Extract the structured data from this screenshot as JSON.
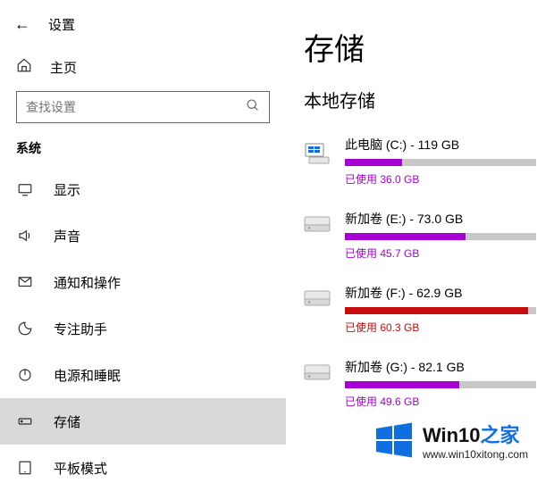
{
  "colors": {
    "purple": "#a600d4",
    "red": "#c60c0c",
    "blue": "#0f6fe0"
  },
  "sidebar": {
    "back_label": "←",
    "title": "设置",
    "home": "主页",
    "search_placeholder": "查找设置",
    "section": "系统",
    "items": [
      {
        "id": "display",
        "icon": "display",
        "label": "显示"
      },
      {
        "id": "sound",
        "icon": "sound",
        "label": "声音"
      },
      {
        "id": "notif",
        "icon": "notif",
        "label": "通知和操作"
      },
      {
        "id": "focus",
        "icon": "focus",
        "label": "专注助手"
      },
      {
        "id": "power",
        "icon": "power",
        "label": "电源和睡眠"
      },
      {
        "id": "storage",
        "icon": "storage",
        "label": "存储",
        "selected": true
      },
      {
        "id": "tablet",
        "icon": "tablet",
        "label": "平板模式"
      }
    ]
  },
  "main": {
    "heading": "存储",
    "subheading": "本地存储",
    "drives": [
      {
        "icon": "pc",
        "title": "此电脑 (C:) - 119 GB",
        "used_text": "已使用 36.0 GB",
        "pct": 30,
        "color": "#a600d4"
      },
      {
        "icon": "disk",
        "title": "新加卷 (E:) - 73.0 GB",
        "used_text": "已使用 45.7 GB",
        "pct": 63,
        "color": "#a600d4"
      },
      {
        "icon": "disk",
        "title": "新加卷 (F:) - 62.9 GB",
        "used_text": "已使用 60.3 GB",
        "pct": 96,
        "color": "#c60c0c"
      },
      {
        "icon": "disk",
        "title": "新加卷 (G:) - 82.1 GB",
        "used_text": "已使用 49.6 GB",
        "pct": 60,
        "color": "#a600d4"
      }
    ]
  },
  "watermark": {
    "line1_a": "Win10",
    "line1_b": "之家",
    "line2": "www.win10xitong.com"
  }
}
